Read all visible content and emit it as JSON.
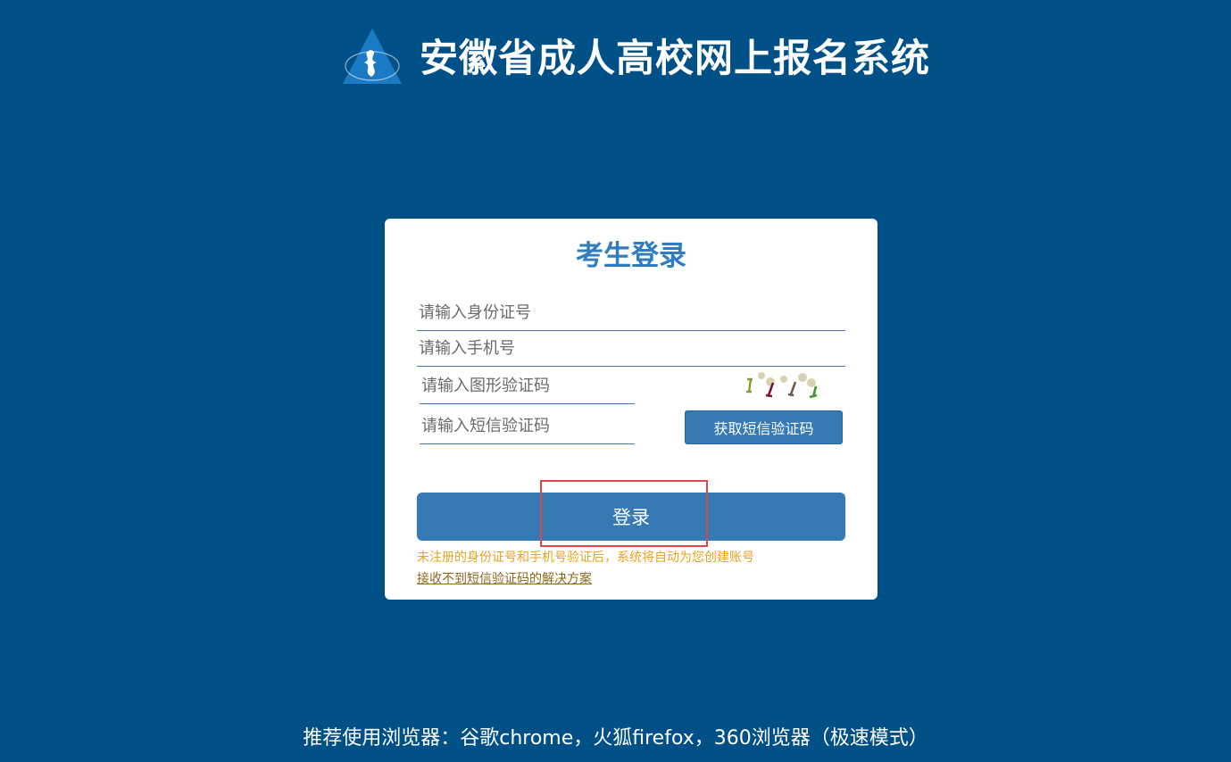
{
  "header": {
    "title": "安徽省成人高校网上报名系统",
    "logo_icon": "triangle-flame-logo"
  },
  "login": {
    "title": "考生登录",
    "id_placeholder": "请输入身份证号",
    "phone_placeholder": "请输入手机号",
    "captcha_placeholder": "请输入图形验证码",
    "sms_placeholder": "请输入短信验证码",
    "sms_button": "获取短信验证码",
    "login_button": "登录",
    "notice": "未注册的身份证号和手机号验证后，系统将自动为您创建账号",
    "help_link": "接收不到短信验证码的解决方案"
  },
  "footer": {
    "browser_tip": "推荐使用浏览器：谷歌chrome，火狐firefox，360浏览器（极速模式）"
  },
  "colors": {
    "background": "#005088",
    "accent": "#3579b5",
    "title": "#2f7dc0",
    "notice": "#e6a220",
    "highlight": "#e04646"
  }
}
